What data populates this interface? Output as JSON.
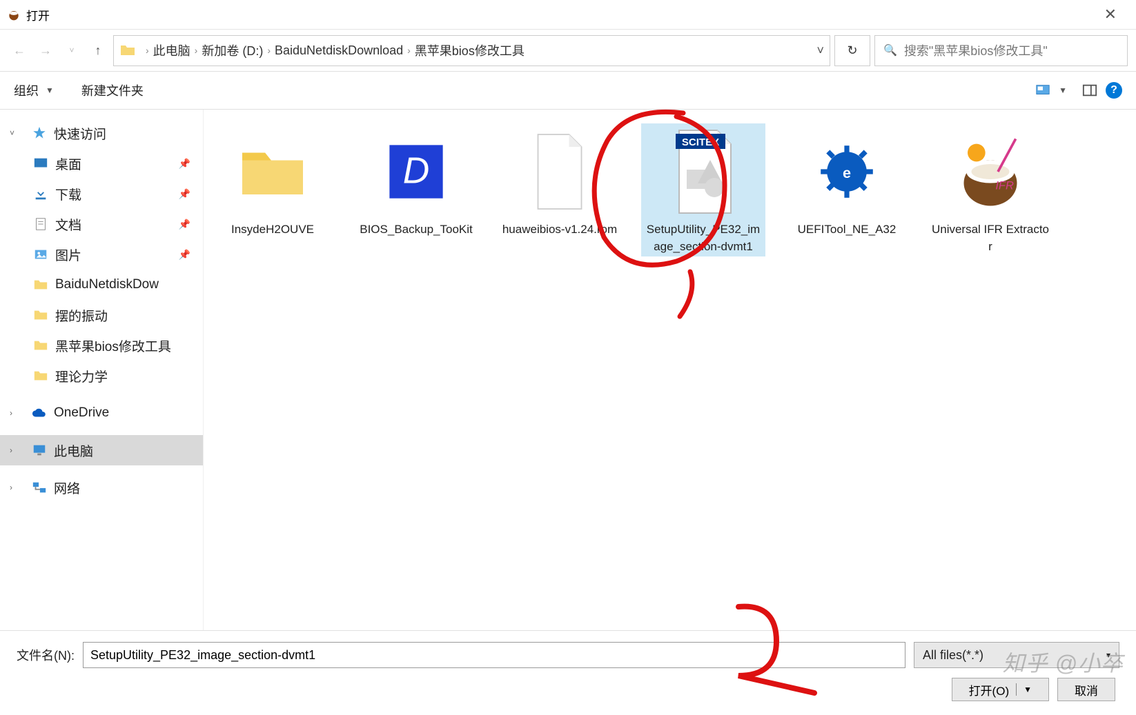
{
  "window": {
    "title": "打开",
    "close": "✕"
  },
  "nav": {
    "path_segments": [
      "此电脑",
      "新加卷 (D:)",
      "BaiduNetdiskDownload",
      "黑苹果bios修改工具"
    ],
    "search_placeholder": "搜索\"黑苹果bios修改工具\""
  },
  "toolbar": {
    "organize": "组织",
    "new_folder": "新建文件夹"
  },
  "sidebar": {
    "quick_access": "快速访问",
    "desktop": "桌面",
    "downloads": "下载",
    "documents": "文档",
    "pictures": "图片",
    "baidu": "BaiduNetdiskDow",
    "vibration": "摆的振动",
    "hackintosh": "黑苹果bios修改工具",
    "mechanics": "理论力学",
    "onedrive": "OneDrive",
    "this_pc": "此电脑",
    "network": "网络"
  },
  "files": [
    {
      "name": "InsydeH2OUVE"
    },
    {
      "name": "BIOS_Backup_TooKit"
    },
    {
      "name": "huaweibios-v1.24.rom"
    },
    {
      "name": "SetupUtility_PE32_image_section-dvmt1"
    },
    {
      "name": "UEFITool_NE_A32"
    },
    {
      "name": "Universal IFR Extractor"
    }
  ],
  "bottom": {
    "filename_label": "文件名(N):",
    "filename_value": "SetupUtility_PE32_image_section-dvmt1",
    "filter": "All files(*.*)",
    "open": "打开(O)",
    "cancel": "取消"
  },
  "watermark": "知乎 @小卒"
}
